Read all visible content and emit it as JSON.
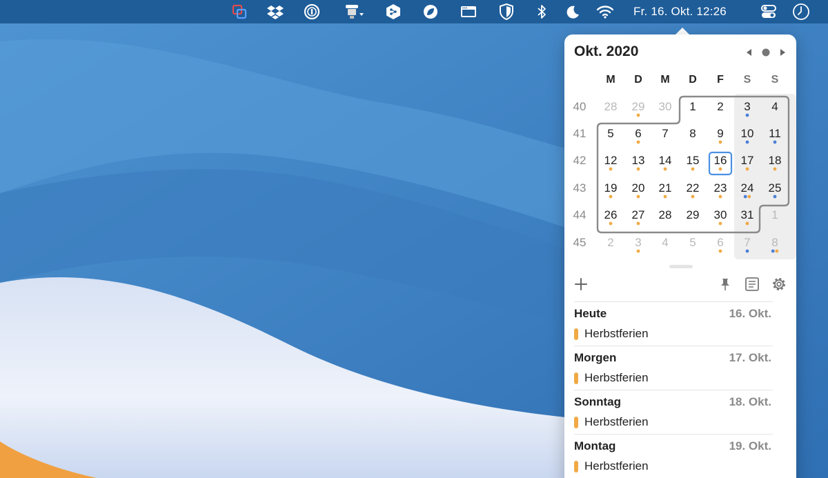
{
  "menubar": {
    "clock": "Fr. 16. Okt. 12:26",
    "icons": [
      "parallels-icon",
      "dropbox-icon",
      "onepassword-icon",
      "bartender-icon",
      "deepl-icon",
      "leaf-icon",
      "window-icon",
      "shield-icon",
      "bluetooth-icon",
      "moon-icon",
      "wifi-icon",
      "control-center-icon",
      "clock-icon"
    ]
  },
  "calendar": {
    "title": "Okt. 2020",
    "weekday_headers": [
      "M",
      "D",
      "M",
      "D",
      "F",
      "S",
      "S"
    ],
    "weeks": [
      {
        "week": "40",
        "days": [
          "28",
          "29",
          "30",
          "1",
          "2",
          "3",
          "4"
        ]
      },
      {
        "week": "41",
        "days": [
          "5",
          "6",
          "7",
          "8",
          "9",
          "10",
          "11"
        ]
      },
      {
        "week": "42",
        "days": [
          "12",
          "13",
          "14",
          "15",
          "16",
          "17",
          "18"
        ]
      },
      {
        "week": "43",
        "days": [
          "19",
          "20",
          "21",
          "22",
          "23",
          "24",
          "25"
        ]
      },
      {
        "week": "44",
        "days": [
          "26",
          "27",
          "28",
          "29",
          "30",
          "31",
          "1"
        ]
      },
      {
        "week": "45",
        "days": [
          "2",
          "3",
          "4",
          "5",
          "6",
          "7",
          "8"
        ]
      }
    ],
    "other_month": [
      [
        0,
        0
      ],
      [
        0,
        1
      ],
      [
        0,
        2
      ],
      [
        4,
        6
      ],
      [
        5,
        0
      ],
      [
        5,
        1
      ],
      [
        5,
        2
      ],
      [
        5,
        3
      ],
      [
        5,
        4
      ],
      [
        5,
        5
      ],
      [
        5,
        6
      ]
    ],
    "today": [
      2,
      4
    ],
    "dots": [
      [
        0,
        1,
        "o"
      ],
      [
        0,
        5,
        "b"
      ],
      [
        1,
        1,
        "o"
      ],
      [
        1,
        4,
        "o"
      ],
      [
        1,
        5,
        "b"
      ],
      [
        1,
        6,
        "b"
      ],
      [
        2,
        0,
        "o"
      ],
      [
        2,
        1,
        "o"
      ],
      [
        2,
        2,
        "o"
      ],
      [
        2,
        3,
        "o"
      ],
      [
        2,
        4,
        "o"
      ],
      [
        2,
        5,
        "o"
      ],
      [
        2,
        6,
        "o"
      ],
      [
        3,
        0,
        "o"
      ],
      [
        3,
        1,
        "o"
      ],
      [
        3,
        2,
        "o"
      ],
      [
        3,
        3,
        "o"
      ],
      [
        3,
        4,
        "o"
      ],
      [
        3,
        5,
        "bo"
      ],
      [
        3,
        6,
        "b"
      ],
      [
        4,
        0,
        "o"
      ],
      [
        4,
        1,
        "o"
      ],
      [
        4,
        4,
        "o"
      ],
      [
        4,
        5,
        "o"
      ],
      [
        5,
        1,
        "o"
      ],
      [
        5,
        4,
        "o"
      ],
      [
        5,
        5,
        "b"
      ],
      [
        5,
        6,
        "bo"
      ]
    ],
    "colors": {
      "orange": "#f0aa45",
      "blue": "#4a7fd8",
      "today_border": "#4a90e2"
    }
  },
  "toolbar": {
    "add_label": "+"
  },
  "events": [
    {
      "day": "Heute",
      "date": "16. Okt.",
      "items": [
        "Herbstferien"
      ]
    },
    {
      "day": "Morgen",
      "date": "17. Okt.",
      "items": [
        "Herbstferien"
      ]
    },
    {
      "day": "Sonntag",
      "date": "18. Okt.",
      "items": [
        "Herbstferien"
      ]
    },
    {
      "day": "Montag",
      "date": "19. Okt.",
      "items": [
        "Herbstferien"
      ]
    }
  ]
}
